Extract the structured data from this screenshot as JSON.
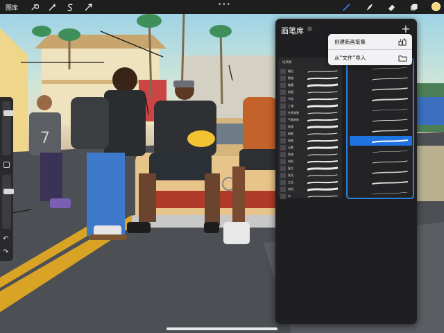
{
  "topbar": {
    "gallery_label": "图库",
    "more_label": "•••",
    "left_tools": [
      "wrench-icon",
      "magic-wand-icon",
      "selection-icon",
      "transform-arrow-icon"
    ],
    "right_tools": [
      "brush-icon",
      "smudge-icon",
      "eraser-icon",
      "layers-icon"
    ],
    "active_tool": "brush-icon",
    "accent_color": "#2f7fe2",
    "current_color": "#f6d97a"
  },
  "sidebar": {
    "undo_glyph": "↶",
    "redo_glyph": "↷",
    "size_level": 0.18,
    "opacity_level": 0.28
  },
  "brush_library": {
    "title": "画笔库",
    "add_glyph": "+",
    "sets_header": "经典集",
    "sets": [
      {
        "label": "最近"
      },
      {
        "label": "素描"
      },
      {
        "label": "着墨"
      },
      {
        "label": "绘图"
      },
      {
        "label": "书法"
      },
      {
        "label": "上漆"
      },
      {
        "label": "艺术效果"
      },
      {
        "label": "气笔修饰"
      },
      {
        "label": "纹理"
      },
      {
        "label": "抽象"
      },
      {
        "label": "炭笔"
      },
      {
        "label": "元素"
      },
      {
        "label": "喷漆"
      },
      {
        "label": "材料"
      },
      {
        "label": "复古"
      },
      {
        "label": "发光"
      },
      {
        "label": "工业"
      },
      {
        "label": "有机"
      },
      {
        "label": "水"
      }
    ],
    "brushes": [
      {
        "name": "",
        "selected": false
      },
      {
        "name": "",
        "selected": false
      },
      {
        "name": "",
        "selected": false
      },
      {
        "name": "",
        "selected": false
      },
      {
        "name": "",
        "selected": false
      },
      {
        "name": "",
        "selected": false
      },
      {
        "name": "",
        "selected": false
      },
      {
        "name": "",
        "selected": true
      },
      {
        "name": "",
        "selected": false
      },
      {
        "name": "",
        "selected": false
      },
      {
        "name": "",
        "selected": false
      },
      {
        "name": "",
        "selected": false
      },
      {
        "name": "",
        "selected": false
      }
    ]
  },
  "popover": {
    "create_label": "创建新画笔集",
    "import_label": "从“文件”导入"
  }
}
